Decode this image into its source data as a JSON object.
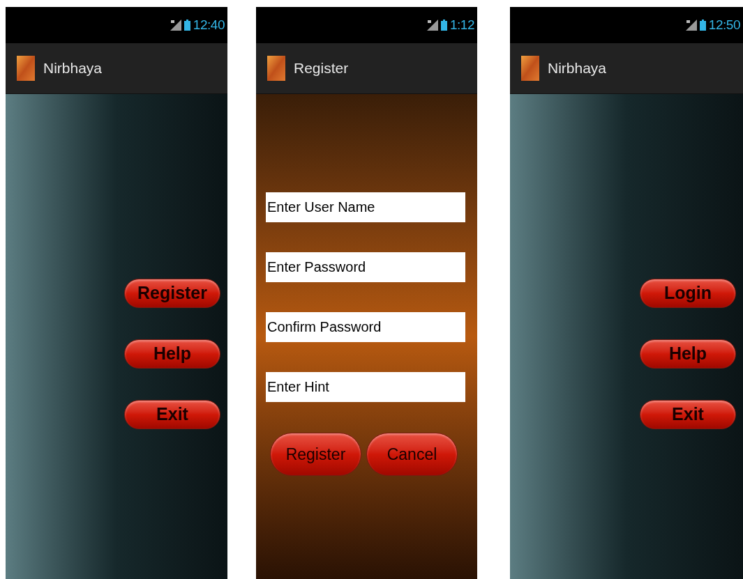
{
  "screens": [
    {
      "kind": "menu",
      "status_bar": {
        "time": "12:40"
      },
      "action_bar": {
        "title": "Nirbhaya"
      },
      "buttons": [
        "Register",
        "Help",
        "Exit"
      ]
    },
    {
      "kind": "form",
      "status_bar": {
        "time": "1:12"
      },
      "action_bar": {
        "title": "Register"
      },
      "fields": [
        {
          "placeholder": "Enter User Name"
        },
        {
          "placeholder": "Enter Password"
        },
        {
          "placeholder": "Confirm Password"
        },
        {
          "placeholder": "Enter Hint"
        }
      ],
      "buttons": [
        "Register",
        "Cancel"
      ]
    },
    {
      "kind": "menu",
      "status_bar": {
        "time": "12:50"
      },
      "action_bar": {
        "title": "Nirbhaya"
      },
      "buttons": [
        "Login",
        "Help",
        "Exit"
      ]
    }
  ]
}
